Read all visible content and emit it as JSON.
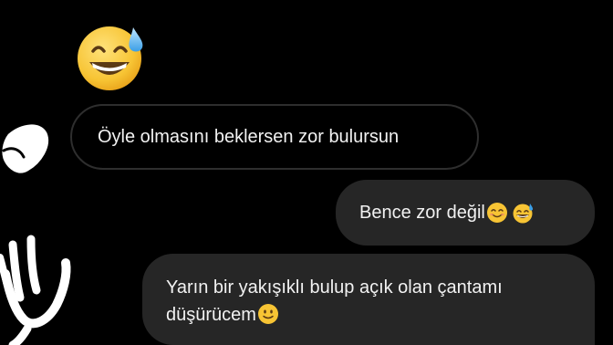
{
  "messages": {
    "reaction_emoji": "grinning-face-with-sweat",
    "received_text": "Öyle olmasını beklersen zor bulursun",
    "sent_1_text": "Bence zor değil",
    "sent_1_emojis": [
      "smiling-face-with-smiling-eyes",
      "grinning-face-with-sweat"
    ],
    "sent_2_line_1": "Yarın bir yakışıklı bulup açık olan çantamı",
    "sent_2_line_2": "düşürücem",
    "sent_2_emoji": "slightly-smiling-face"
  },
  "colors": {
    "background": "#000000",
    "sent_bubble": "#262626",
    "received_border": "#2e2e2e",
    "text": "#f2f2f2",
    "emoji_yellow": "#f7c434",
    "scribble": "#ffffff"
  }
}
